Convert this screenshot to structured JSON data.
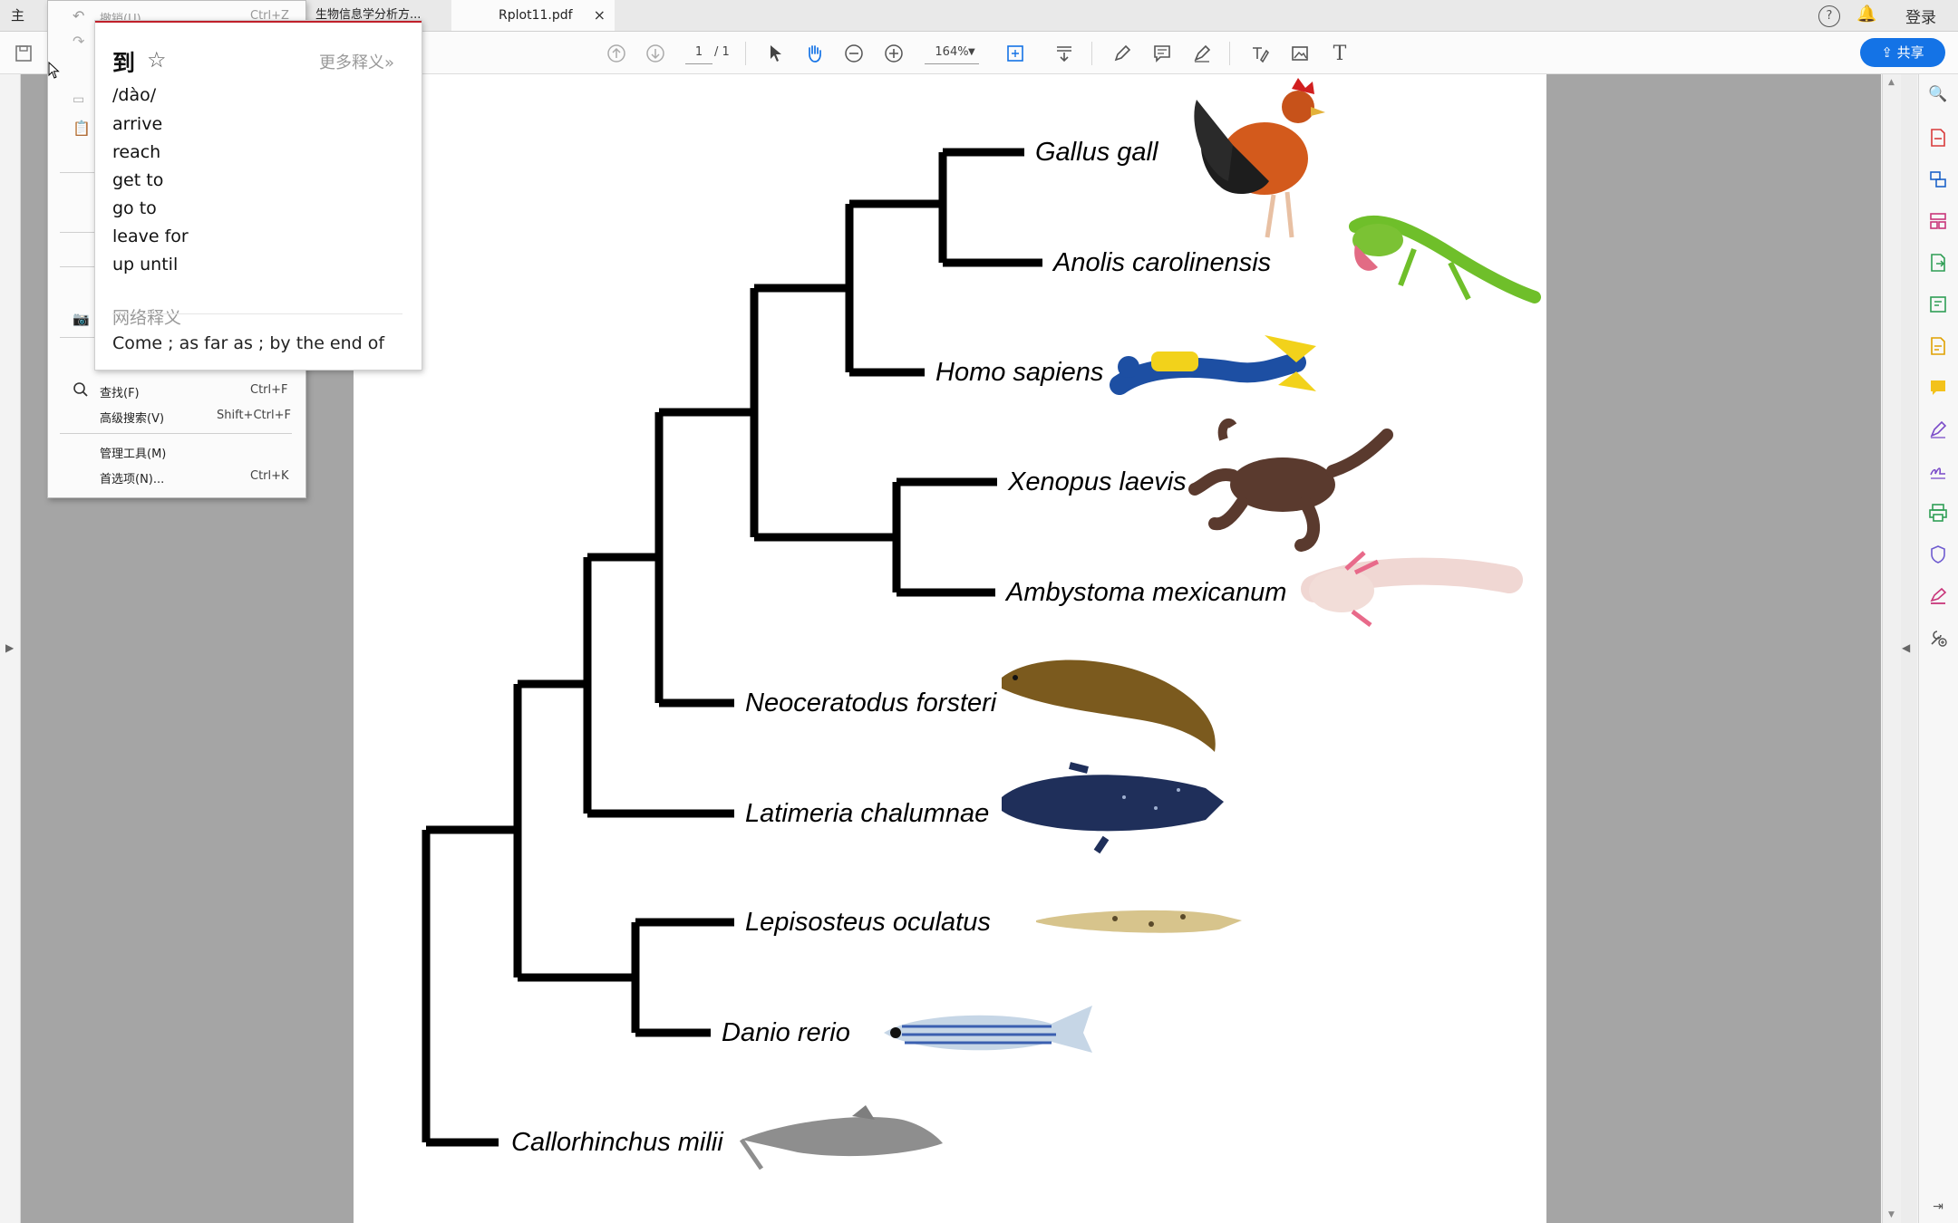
{
  "titlebar": {
    "home_label": "主页",
    "tabs": [
      {
        "label": "生物信息学分析方..."
      },
      {
        "label": "Rplot11.pdf",
        "close": "×"
      }
    ],
    "login_label": "登录"
  },
  "toolbar": {
    "page_current": "1",
    "page_total": "/ 1",
    "zoom": "164%",
    "share_label": "共享"
  },
  "menu": {
    "undo_label": "撤销(U)",
    "undo_shortcut": "Ctrl+Z",
    "items": [
      {
        "label": "查找(F)",
        "shortcut": "Ctrl+F"
      },
      {
        "label": "高级搜索(V)",
        "shortcut": "Shift+Ctrl+F"
      },
      {
        "label": "管理工具(M)",
        "shortcut": ""
      },
      {
        "label": "首选项(N)...",
        "shortcut": "Ctrl+K"
      }
    ]
  },
  "dictionary": {
    "headword": "到",
    "more_link": "更多释义»",
    "pronunciation": "/dào/",
    "meanings": [
      "arrive",
      "reach",
      "get to",
      "go to",
      "leave for",
      "up until"
    ],
    "web_heading": "网络释义",
    "web_meaning": "Come ; as far as ; by the end of"
  },
  "tree": {
    "species": [
      {
        "name": "Gallus gall",
        "image": "rooster"
      },
      {
        "name": "Anolis carolinensis",
        "image": "lizard"
      },
      {
        "name": "Homo sapiens",
        "image": "diver"
      },
      {
        "name": "Xenopus laevis",
        "image": "frog"
      },
      {
        "name": "Ambystoma mexicanum",
        "image": "axolotl"
      },
      {
        "name": "Neoceratodus forsteri",
        "image": "lungfish"
      },
      {
        "name": "Latimeria chalumnae",
        "image": "coelacanth"
      },
      {
        "name": "Lepisosteus oculatus",
        "image": "gar"
      },
      {
        "name": "Danio rerio",
        "image": "zebrafish"
      },
      {
        "name": "Callorhinchus milii",
        "image": "elephant-shark"
      }
    ]
  }
}
